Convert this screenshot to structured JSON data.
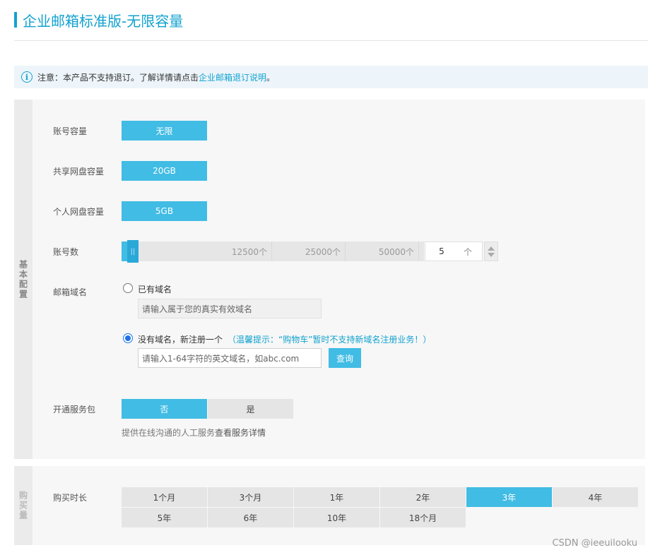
{
  "page": {
    "title": "企业邮箱标准版-无限容量"
  },
  "notice": {
    "icon": "info-icon",
    "text": "注意：本产品不支持退订。了解详情请点击",
    "link": "企业邮箱退订说明",
    "suffix": "。"
  },
  "basic": {
    "side_label": "基本配置",
    "account_capacity": {
      "label": "账号容量",
      "value": "无限"
    },
    "shared_disk": {
      "label": "共享网盘容量",
      "value": "20GB"
    },
    "personal_disk": {
      "label": "个人网盘容量",
      "value": "5GB"
    },
    "account_count": {
      "label": "账号数",
      "handle_glyph": "||",
      "ticks": [
        "12500个",
        "25000个",
        "50000个"
      ],
      "value": "5",
      "unit": "个",
      "slider_position": 0.0
    },
    "domain": {
      "label": "邮箱域名",
      "option_existing": "已有域名",
      "existing_placeholder": "请输入属于您的真实有效域名",
      "option_new": "没有域名，新注册一个",
      "tip": "（温馨提示：“购物车”暂时不支持新域名注册业务！）",
      "new_placeholder": "请输入1-64字符的英文域名，如abc.com",
      "query_button": "查询",
      "selected": "new"
    },
    "service_pack": {
      "label": "开通服务包",
      "options": [
        "否",
        "是"
      ],
      "selected": "否",
      "desc": "提供在线沟通的人工服务",
      "desc_link": "查看服务详情"
    }
  },
  "purchase": {
    "side_label": "购买量",
    "duration": {
      "label": "购买时长",
      "row1": [
        "1个月",
        "3个月",
        "1年",
        "2年",
        "3年",
        "4年"
      ],
      "row2": [
        "5年",
        "6年",
        "10年",
        "18个月"
      ],
      "selected": "3年"
    }
  },
  "watermark": "CSDN @ieeuilooku",
  "colors": {
    "accent": "#41bce4",
    "title": "#12a2cf",
    "panel_bg": "#f7f7f7"
  }
}
